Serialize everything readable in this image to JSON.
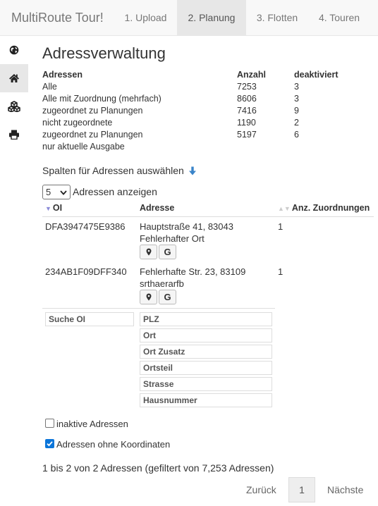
{
  "navbar": {
    "brand": "MultiRoute Tour!",
    "tabs": [
      {
        "label": "1. Upload"
      },
      {
        "label": "2. Planung"
      },
      {
        "label": "3. Flotten"
      },
      {
        "label": "4. Touren"
      }
    ]
  },
  "rail": {
    "items": [
      {
        "icon": "globe-icon"
      },
      {
        "icon": "home-icon"
      },
      {
        "icon": "cubes-icon"
      },
      {
        "icon": "print-icon"
      }
    ]
  },
  "page": {
    "title": "Adressverwaltung"
  },
  "summary": {
    "headers": {
      "label": "Adressen",
      "count": "Anzahl",
      "deactivated": "deaktiviert"
    },
    "rows": [
      {
        "label": "Alle",
        "count": "7253",
        "deactivated": "3"
      },
      {
        "label": "Alle mit Zuordnung (mehrfach)",
        "count": "8606",
        "deactivated": "3"
      },
      {
        "label": "zugeordnet zu Planungen",
        "count": "7416",
        "deactivated": "9"
      },
      {
        "label": "nicht zugeordnete",
        "count": "1190",
        "deactivated": "2"
      },
      {
        "label": "zugeordnet zu Planungen",
        "count": "5197",
        "deactivated": "6"
      },
      {
        "label": "nur aktuelle Ausgabe",
        "count": "",
        "deactivated": ""
      }
    ]
  },
  "columns_link": "Spalten für Adressen auswählen",
  "length": {
    "selected": "5",
    "label": "Adressen anzeigen"
  },
  "table": {
    "headers": {
      "oi": "OI",
      "address": "Adresse",
      "assignments": "Anz. Zuordnungen"
    },
    "rows": [
      {
        "oi": "DFA3947475E9386",
        "address_line1": "Hauptstraße 41, 83043",
        "address_line2": "Fehlerhafter Ort",
        "assignments": "1"
      },
      {
        "oi": "234AB1F09DFF340",
        "address_line1": "Fehlerhafte Str. 23, 83109",
        "address_line2": "srthaerarfb",
        "assignments": "1"
      }
    ],
    "g_button": "G"
  },
  "filters": {
    "oi": "Suche OI",
    "plz": "PLZ",
    "ort": "Ort",
    "ort_zusatz": "Ort Zusatz",
    "ortsteil": "Ortsteil",
    "strasse": "Strasse",
    "hausnummer": "Hausnummer"
  },
  "options": {
    "inactive": {
      "label": "inaktive Adressen",
      "checked": false
    },
    "no_coords": {
      "label": "Adressen ohne Koordinaten",
      "checked": true
    }
  },
  "info": "1 bis 2 von 2 Adressen (gefiltert von 7,253 Adressen)",
  "pagination": {
    "prev": "Zurück",
    "current": "1",
    "next": "Nächste"
  },
  "colors": {
    "accent": "#0b75d9",
    "sort_arrow": "#8a8ad8"
  }
}
